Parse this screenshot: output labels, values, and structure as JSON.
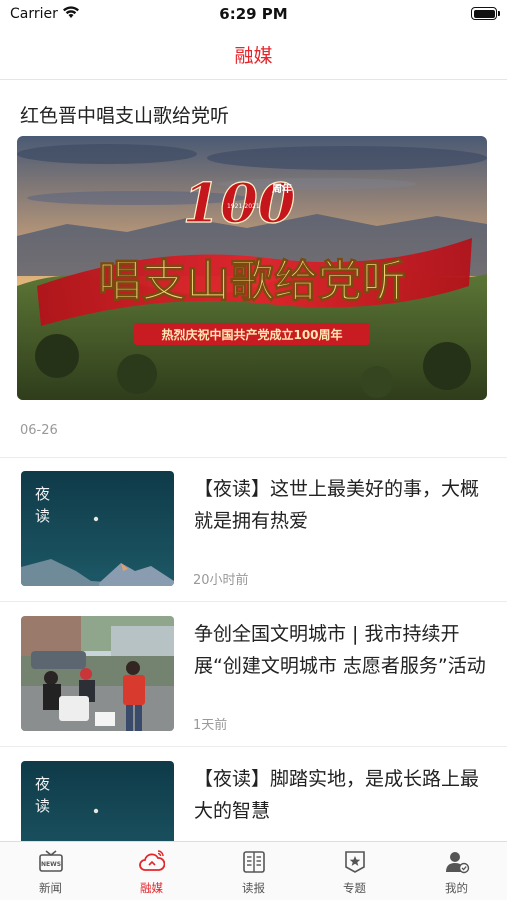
{
  "status_bar": {
    "carrier": "Carrier",
    "time": "6:29 PM"
  },
  "nav": {
    "title": "融媒"
  },
  "feature": {
    "title": "红色晋中唱支山歌给党听",
    "banner": {
      "number": "100",
      "years": "1921-2021",
      "anniversary": "周年",
      "calligraphy": "唱支山歌给党听",
      "ribbon": "热烈庆祝中国共产党成立100周年"
    },
    "date": "06-26"
  },
  "articles": [
    {
      "title": "【夜读】这世上最美好的事，大概就是拥有热爱",
      "time": "20小时前",
      "thumb_text": "夜读"
    },
    {
      "title": "争创全国文明城市 | 我市持续开展“创建文明城市 志愿者服务”活动",
      "time": "1天前"
    },
    {
      "title": "【夜读】脚踏实地，是成长路上最大的智慧",
      "time": "",
      "thumb_text": "夜读"
    }
  ],
  "tabs": [
    {
      "label": "新闻",
      "icon": "news-tv-icon",
      "active": false
    },
    {
      "label": "融媒",
      "icon": "rongmei-cloud-icon",
      "active": true
    },
    {
      "label": "读报",
      "icon": "newspaper-icon",
      "active": false
    },
    {
      "label": "专题",
      "icon": "topic-badge-icon",
      "active": false
    },
    {
      "label": "我的",
      "icon": "profile-icon",
      "active": false
    }
  ],
  "colors": {
    "accent": "#e4262c",
    "inactive": "#555555",
    "muted": "#999999"
  }
}
